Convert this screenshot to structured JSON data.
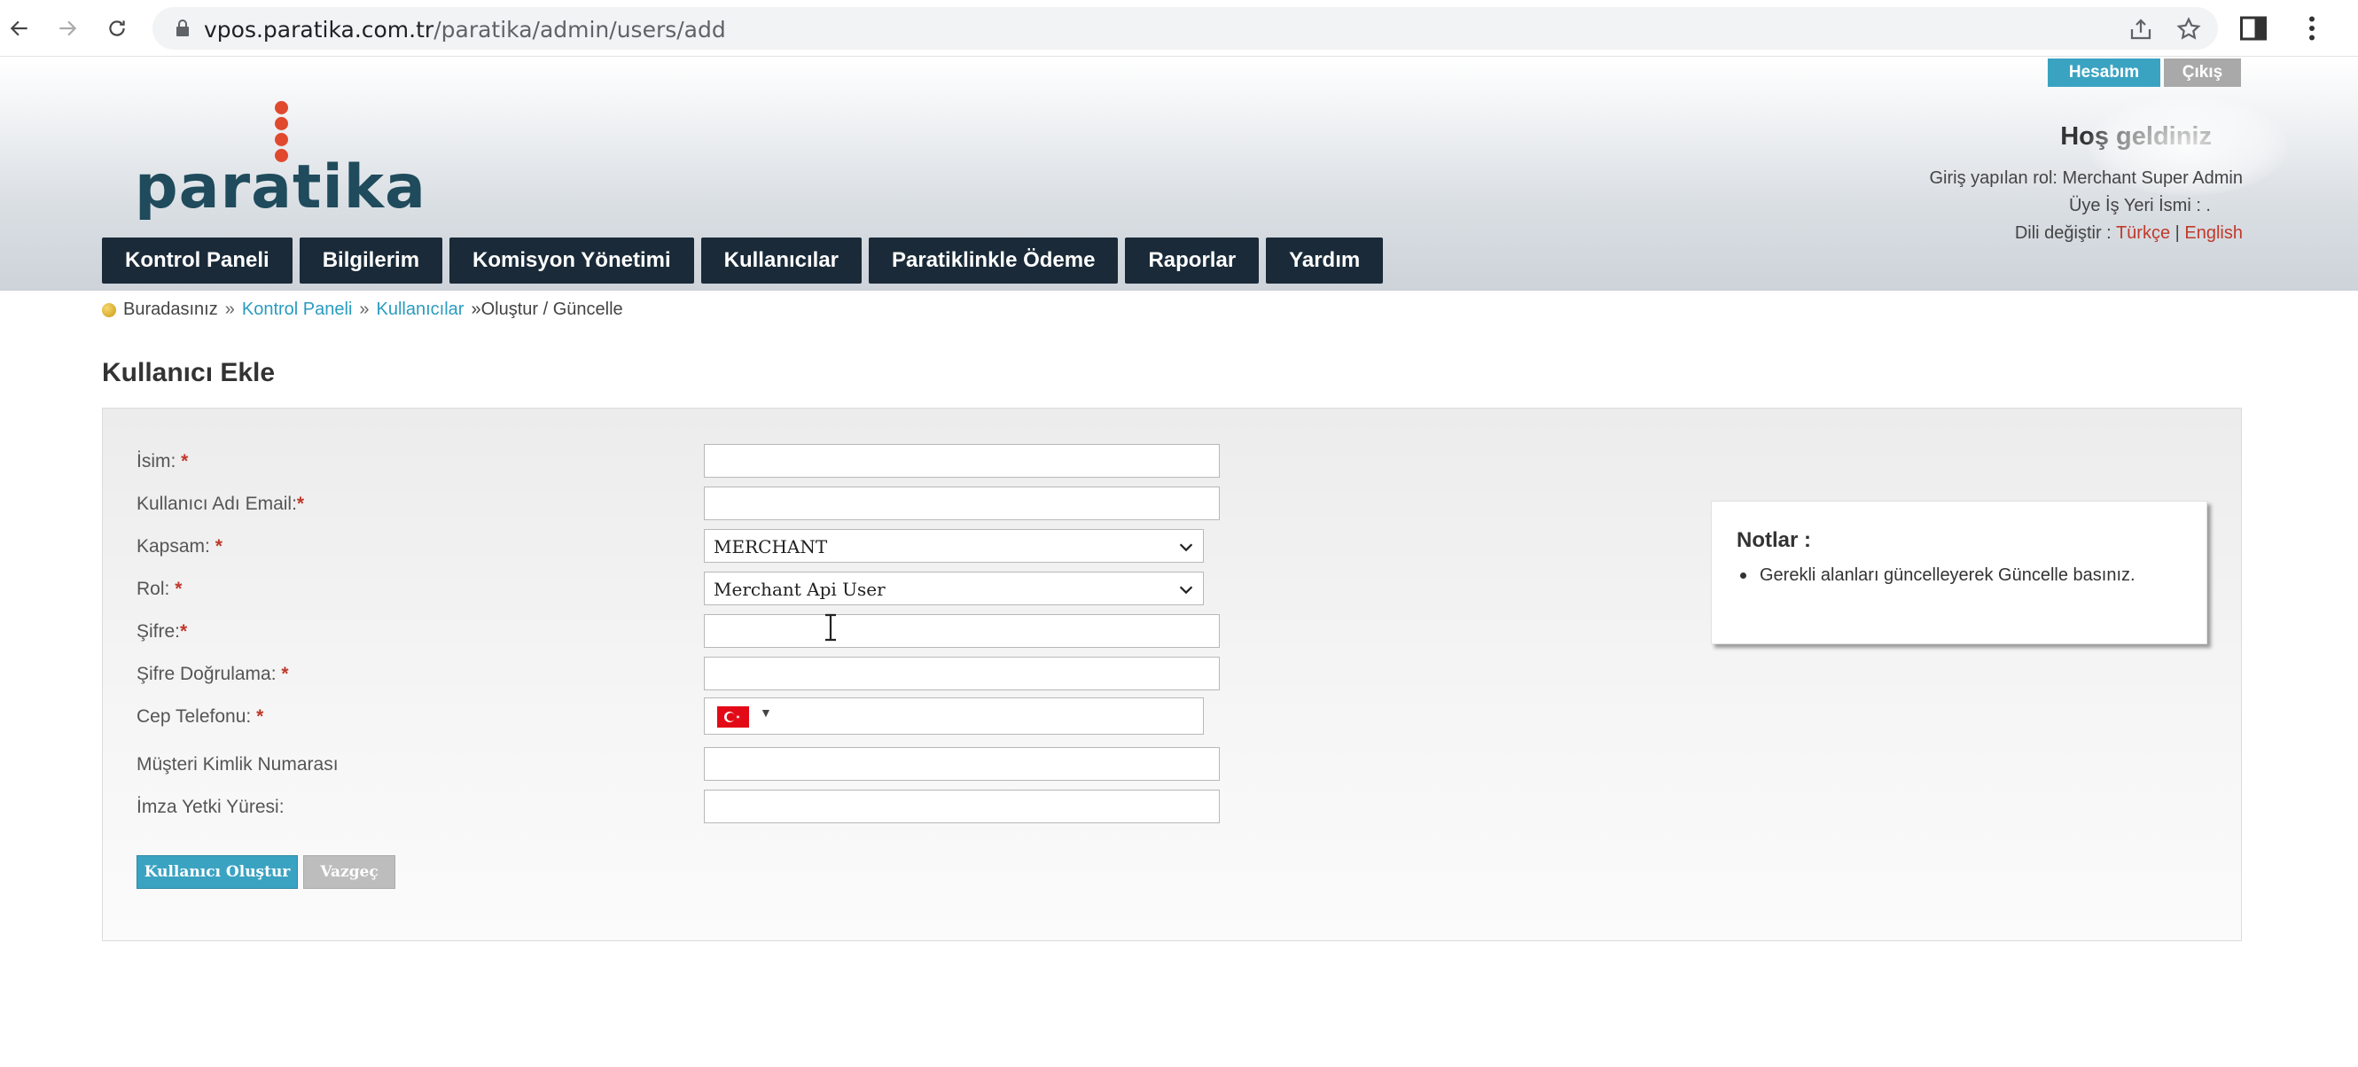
{
  "browser": {
    "url_host": "vpos.paratika.com.tr",
    "url_path": "/paratika/admin/users/add"
  },
  "header": {
    "logo_text": "paratika",
    "account_button": "Hesabım",
    "logout_button": "Çıkış",
    "welcome": "Hoş geldiniz",
    "role_line": "Giriş yapılan rol: Merchant Super Admin",
    "merchant_line": "Üye İş Yeri İsmi : .",
    "lang_label": "Dili değiştir :",
    "lang_tr": "Türkçe",
    "lang_sep": "|",
    "lang_en": "English"
  },
  "nav": {
    "items": [
      "Kontrol Paneli",
      "Bilgilerim",
      "Komisyon Yönetimi",
      "Kullanıcılar",
      "Paratiklinkle Ödeme",
      "Raporlar",
      "Yardım"
    ]
  },
  "breadcrumb": {
    "here": "Buradasınız",
    "sep": "»",
    "link1": "Kontrol Paneli",
    "link2": "Kullanıcılar",
    "current": "»Oluştur / Güncelle"
  },
  "page": {
    "title": "Kullanıcı Ekle"
  },
  "form": {
    "required_mark": "*",
    "fields": [
      {
        "label": "İsim:",
        "value": ""
      },
      {
        "label": "Kullanıcı Adı Email:",
        "value": ""
      },
      {
        "label": "Kapsam:",
        "value": "MERCHANT"
      },
      {
        "label": "Rol:",
        "value": "Merchant Api User"
      },
      {
        "label": "Şifre:",
        "value": ""
      },
      {
        "label": "Şifre Doğrulama:",
        "value": ""
      },
      {
        "label": "Cep Telefonu:",
        "value": ""
      },
      {
        "label": "Müşteri Kimlik Numarası",
        "value": ""
      },
      {
        "label": "İmza Yetki Yüresi:",
        "value": ""
      }
    ],
    "create_button": "Kullanıcı Oluştur",
    "cancel_button": "Vazgeç"
  },
  "notes": {
    "title": "Notlar :",
    "items": [
      "Gerekli alanları güncelleyerek Güncelle basınız."
    ]
  },
  "colors": {
    "nav_bg": "#1a2a38",
    "accent": "#3aa3c2",
    "required": "#c0392b",
    "logo": "#1f4b5c",
    "logo_dot": "#e0492e"
  }
}
